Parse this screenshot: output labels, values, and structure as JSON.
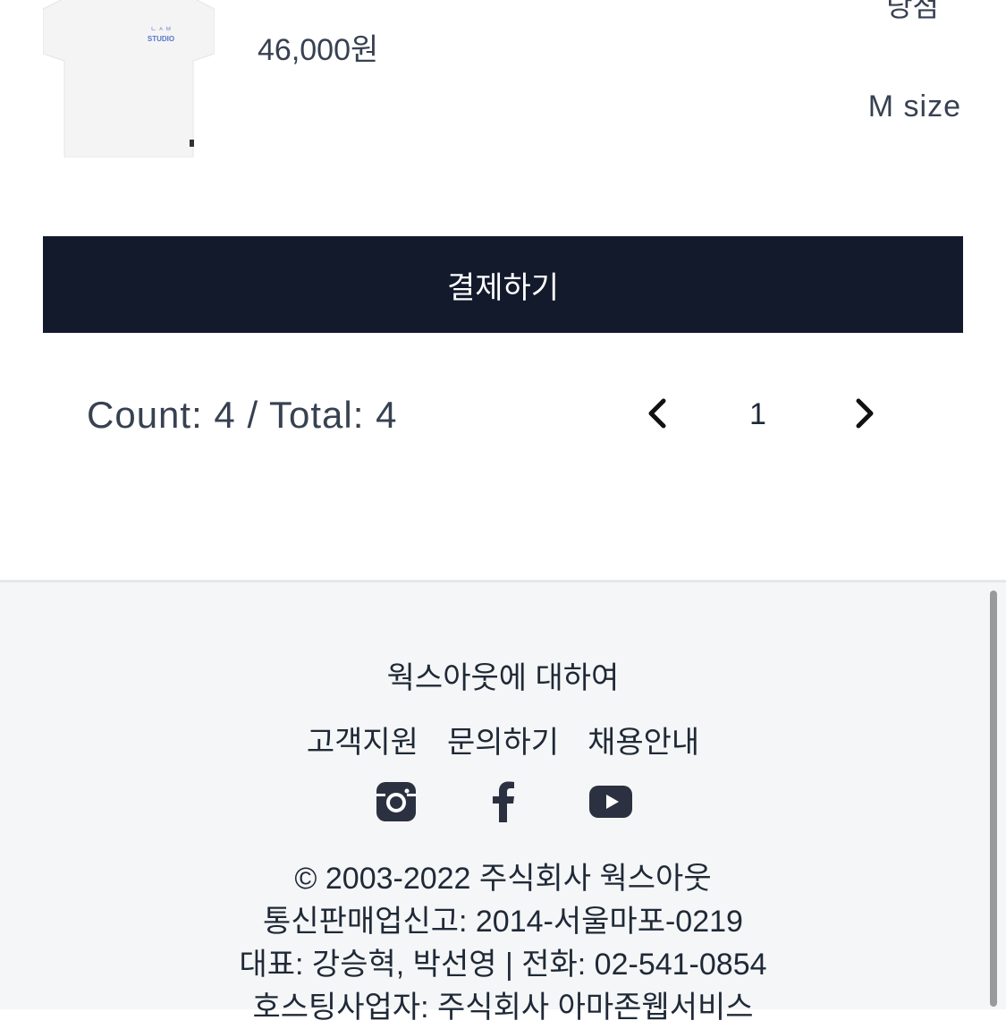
{
  "product": {
    "price": "46,000원",
    "status": "당첨",
    "size": "M size",
    "thumbnail_text": "STUDIO"
  },
  "checkout": {
    "pay_label": "결제하기"
  },
  "pagination": {
    "count_text": "Count: 4 / Total: 4",
    "current_page": "1"
  },
  "footer": {
    "about": "웍스아웃에 대하여",
    "links": [
      "고객지원",
      "문의하기",
      "채용안내"
    ],
    "social_icons": [
      "instagram-icon",
      "facebook-icon",
      "youtube-icon"
    ],
    "legal": [
      "© 2003-2022 주식회사 웍스아웃",
      "통신판매업신고: 2014-서울마포-0219",
      "대표: 강승혁, 박선영 | 전화: 02-541-0854",
      "호스팅사업자: 주식회사 아마존웹서비스"
    ]
  },
  "colors": {
    "button_bg": "#131a2c",
    "footer_bg": "#f5f6f7",
    "icon": "#2b3140"
  }
}
